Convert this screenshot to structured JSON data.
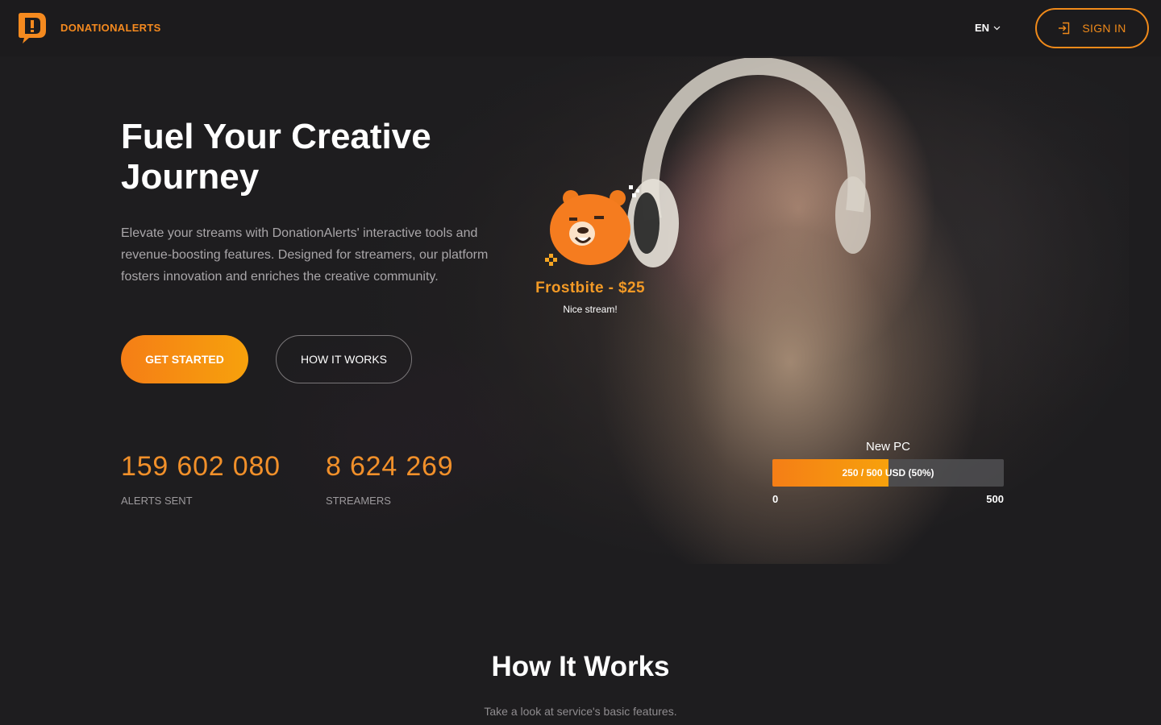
{
  "brand": {
    "name": "DONATIONALERTS",
    "accent": "#f58a1f"
  },
  "header": {
    "language": "EN",
    "signin_label": "SIGN IN",
    "signin_icon": "login-icon"
  },
  "hero": {
    "title": "Fuel Your Creative Journey",
    "description": "Elevate your streams with DonationAlerts' interactive tools and revenue-boosting features. Designed for streamers, our platform fosters innovation and enriches the creative community.",
    "primary_button": "GET STARTED",
    "secondary_button": "HOW IT WORKS",
    "stats": [
      {
        "value": "159 602 080",
        "label": "ALERTS SENT"
      },
      {
        "value": "8 624 269",
        "label": "STREAMERS"
      }
    ]
  },
  "alert_widget": {
    "title": "Frostbite - $25",
    "message": "Nice stream!",
    "icon": "bear-mascot-icon"
  },
  "goal_widget": {
    "title": "New PC",
    "progress_text": "250 / 500 USD (50%)",
    "progress": 0.5,
    "min_label": "0",
    "max_label": "500"
  },
  "section": {
    "title": "How It Works",
    "subtitle": "Take a look at service's basic features."
  }
}
